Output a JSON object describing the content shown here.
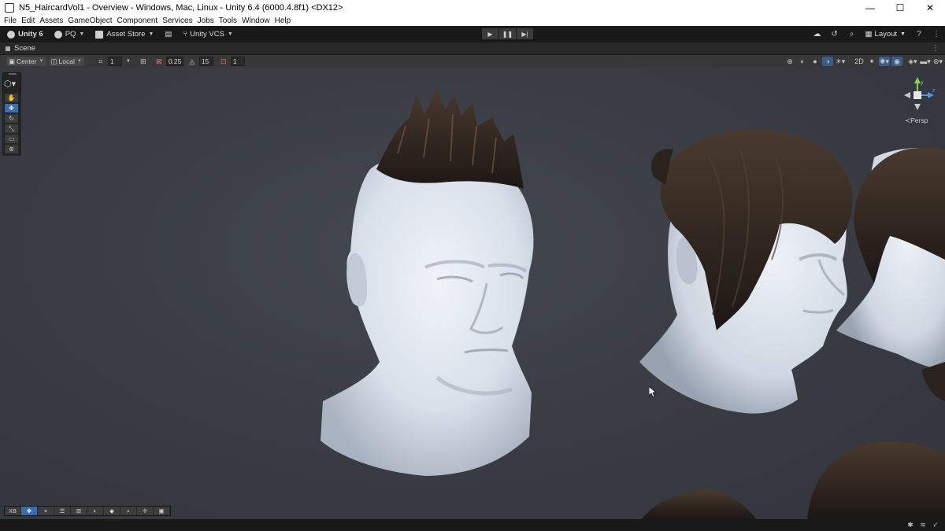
{
  "window": {
    "title": "N5_HaircardVol1 - Overview - Windows, Mac, Linux - Unity 6.4 (6000.4.8f1) <DX12>",
    "minimize": "—",
    "maximize": "☐",
    "close": "✕"
  },
  "menu": [
    "File",
    "Edit",
    "Assets",
    "GameObject",
    "Component",
    "Services",
    "Jobs",
    "Tools",
    "Window",
    "Help"
  ],
  "toolbar": {
    "unity_label": "Unity 6",
    "account_label": "PQ",
    "asset_store_label": "Asset Store",
    "vcs_label": "Unity VCS",
    "layout_label": "Layout"
  },
  "scene_tab": {
    "label": "Scene"
  },
  "scene_toolbar": {
    "pivot_label": "Center",
    "space_label": "Local",
    "grid_size": "1",
    "snap_increment": "0.25",
    "rotate_snap": "15",
    "scale_snap": "1"
  },
  "viewport": {
    "projection_label": "Persp",
    "axis_y": "y",
    "axis_z": "z",
    "background": "#3a3d44"
  },
  "bottom_tools": {
    "xr_label": "XB"
  },
  "colors": {
    "accent": "#3d6da8",
    "skin": "#e4e9f0",
    "hair": "#2a221d"
  }
}
